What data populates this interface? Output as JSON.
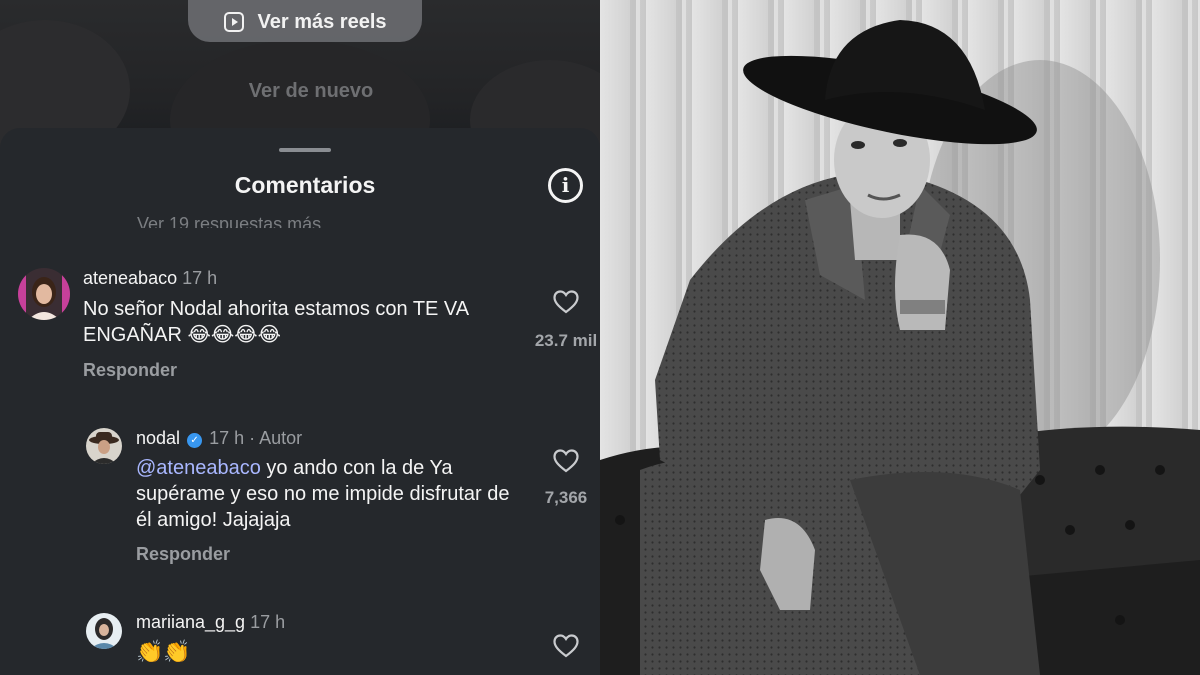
{
  "reel": {
    "more_reels_label": "Ver más reels",
    "watch_again_label": "Ver de nuevo"
  },
  "sheet": {
    "title": "Comentarios",
    "info_icon": "info-icon",
    "hidden_replies_text": "Ver 19 respuestas más"
  },
  "comments": [
    {
      "username": "ateneabaco",
      "time": "17 h",
      "text": "No señor Nodal ahorita estamos con TE VA ENGAÑAR 😂😂😂😂",
      "reply_label": "Responder",
      "likes": "23.7 mil"
    },
    {
      "username": "nodal",
      "time": "17 h",
      "author_label": "Autor",
      "mention": "@ateneabaco",
      "text": "yo ando con la de Ya supérame y eso no me impide disfrutar de él amigo! Jajajaja",
      "reply_label": "Responder",
      "likes": "7,366"
    },
    {
      "username": "mariiana_g_g",
      "time": "17 h",
      "text": "👏👏",
      "likes": ""
    }
  ],
  "colors": {
    "sheet_bg": "#25282c",
    "mention": "#a9b7ff",
    "verified": "#3897f0"
  },
  "photo": {
    "subject": "black-and-white portrait of a man in a black cowboy hat and leather jacket seated on a tufted sofa"
  }
}
